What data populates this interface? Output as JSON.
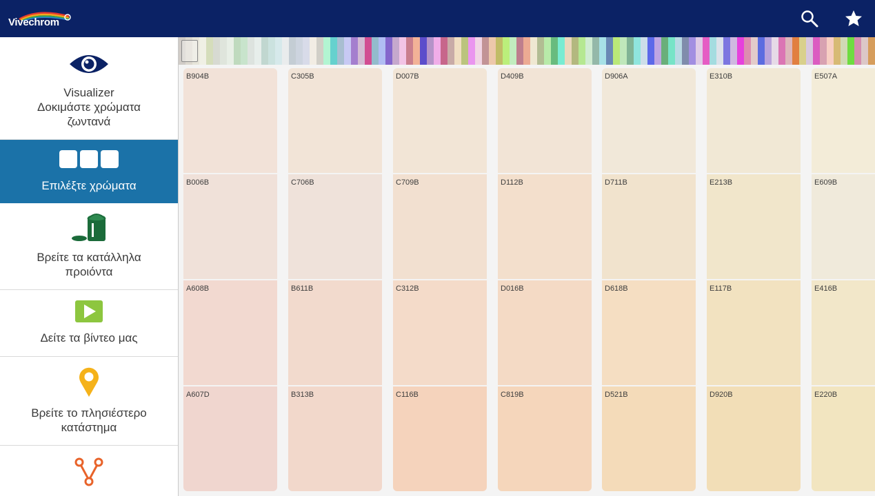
{
  "app": {
    "logo_text": "Vivechrom"
  },
  "header": {
    "icons": [
      "search-icon",
      "star-icon"
    ]
  },
  "sidebar": {
    "items": [
      {
        "id": "visualizer",
        "label_lines": [
          "Visualizer",
          "Δοκιμάστε χρώματα",
          "ζωντανά"
        ],
        "icon": "eye-icon",
        "active": false
      },
      {
        "id": "choose-colors",
        "label_lines": [
          "Επιλέξτε χρώματα"
        ],
        "icon": "swatches-icon",
        "active": true
      },
      {
        "id": "products",
        "label_lines": [
          "Βρείτε τα κατάλληλα",
          "προιόντα"
        ],
        "icon": "paint-can-icon",
        "active": false
      },
      {
        "id": "videos",
        "label_lines": [
          "Δείτε τα βίντεο μας"
        ],
        "icon": "play-icon",
        "active": false
      },
      {
        "id": "store",
        "label_lines": [
          "Βρείτε το πλησιέστερο",
          "κατάστημα"
        ],
        "icon": "location-pin-icon",
        "active": false
      },
      {
        "id": "share",
        "label_lines": [],
        "icon": "share-icon",
        "active": false
      }
    ]
  },
  "colors": {
    "header_bg": "#0b2265",
    "active_item_bg": "#1b72a8"
  },
  "swatch_grid": {
    "columns": [
      [
        {
          "code": "B904B",
          "color": "#f2e2d8"
        },
        {
          "code": "B006B",
          "color": "#f0e1d9"
        },
        {
          "code": "A608B",
          "color": "#f2d9d0"
        },
        {
          "code": "A607D",
          "color": "#f0d6cf"
        }
      ],
      [
        {
          "code": "C305B",
          "color": "#f2e4d7"
        },
        {
          "code": "C706B",
          "color": "#efe2da"
        },
        {
          "code": "B611B",
          "color": "#f2dacd"
        },
        {
          "code": "B313B",
          "color": "#f2d8cb"
        }
      ],
      [
        {
          "code": "D007B",
          "color": "#f2e5d6"
        },
        {
          "code": "C709B",
          "color": "#f2e0d0"
        },
        {
          "code": "C312B",
          "color": "#f4dbc9"
        },
        {
          "code": "C116B",
          "color": "#f5d3bc"
        }
      ],
      [
        {
          "code": "D409B",
          "color": "#f2e4d6"
        },
        {
          "code": "D112B",
          "color": "#f3dfcc"
        },
        {
          "code": "D016B",
          "color": "#f4dac5"
        },
        {
          "code": "C819B",
          "color": "#f5d6bb"
        }
      ],
      [
        {
          "code": "D906A",
          "color": "#f1e8d9"
        },
        {
          "code": "D711B",
          "color": "#f1e3cd"
        },
        {
          "code": "D618B",
          "color": "#f5dec2"
        },
        {
          "code": "D521B",
          "color": "#f4dbb9"
        }
      ],
      [
        {
          "code": "E310B",
          "color": "#f1e8d5"
        },
        {
          "code": "E213B",
          "color": "#f1e6cb"
        },
        {
          "code": "E117B",
          "color": "#f2e2c0"
        },
        {
          "code": "D920B",
          "color": "#f2deb7"
        }
      ],
      [
        {
          "code": "E507A",
          "color": "#f3ecd8"
        },
        {
          "code": "E609B",
          "color": "#f0eadb"
        },
        {
          "code": "E416B",
          "color": "#f2e7c9"
        },
        {
          "code": "E220B",
          "color": "#f2e5c0"
        }
      ]
    ]
  }
}
